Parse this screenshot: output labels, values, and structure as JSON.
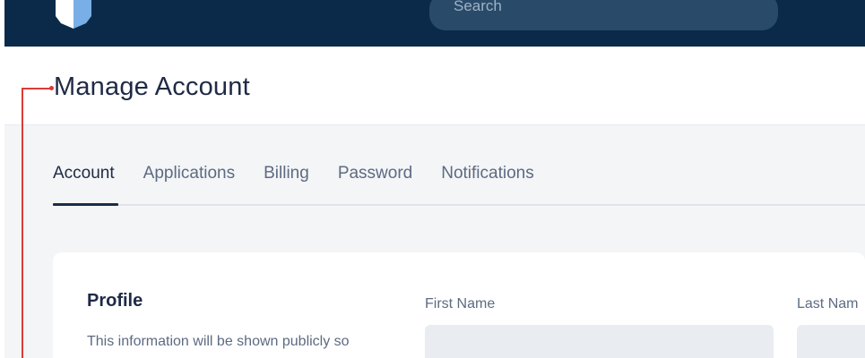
{
  "header": {
    "search_placeholder": "Search"
  },
  "page": {
    "title": "Manage Account"
  },
  "tabs": [
    {
      "label": "Account",
      "active": true
    },
    {
      "label": "Applications",
      "active": false
    },
    {
      "label": "Billing",
      "active": false
    },
    {
      "label": "Password",
      "active": false
    },
    {
      "label": "Notifications",
      "active": false
    }
  ],
  "profile": {
    "title": "Profile",
    "description": "This information will be shown publicly so",
    "first_name_label": "First Name",
    "last_name_label": "Last Nam",
    "first_name_value": "",
    "last_name_value": ""
  },
  "colors": {
    "navbar": "#0b2a4a",
    "search_bg": "#2a4a69",
    "content_bg": "#f4f5f7",
    "input_bg": "#e9edf2",
    "annotation": "#d93b3b",
    "text_primary": "#1f2a44",
    "text_secondary": "#5c6b82"
  },
  "icons": {
    "logo": "logo-icon"
  }
}
